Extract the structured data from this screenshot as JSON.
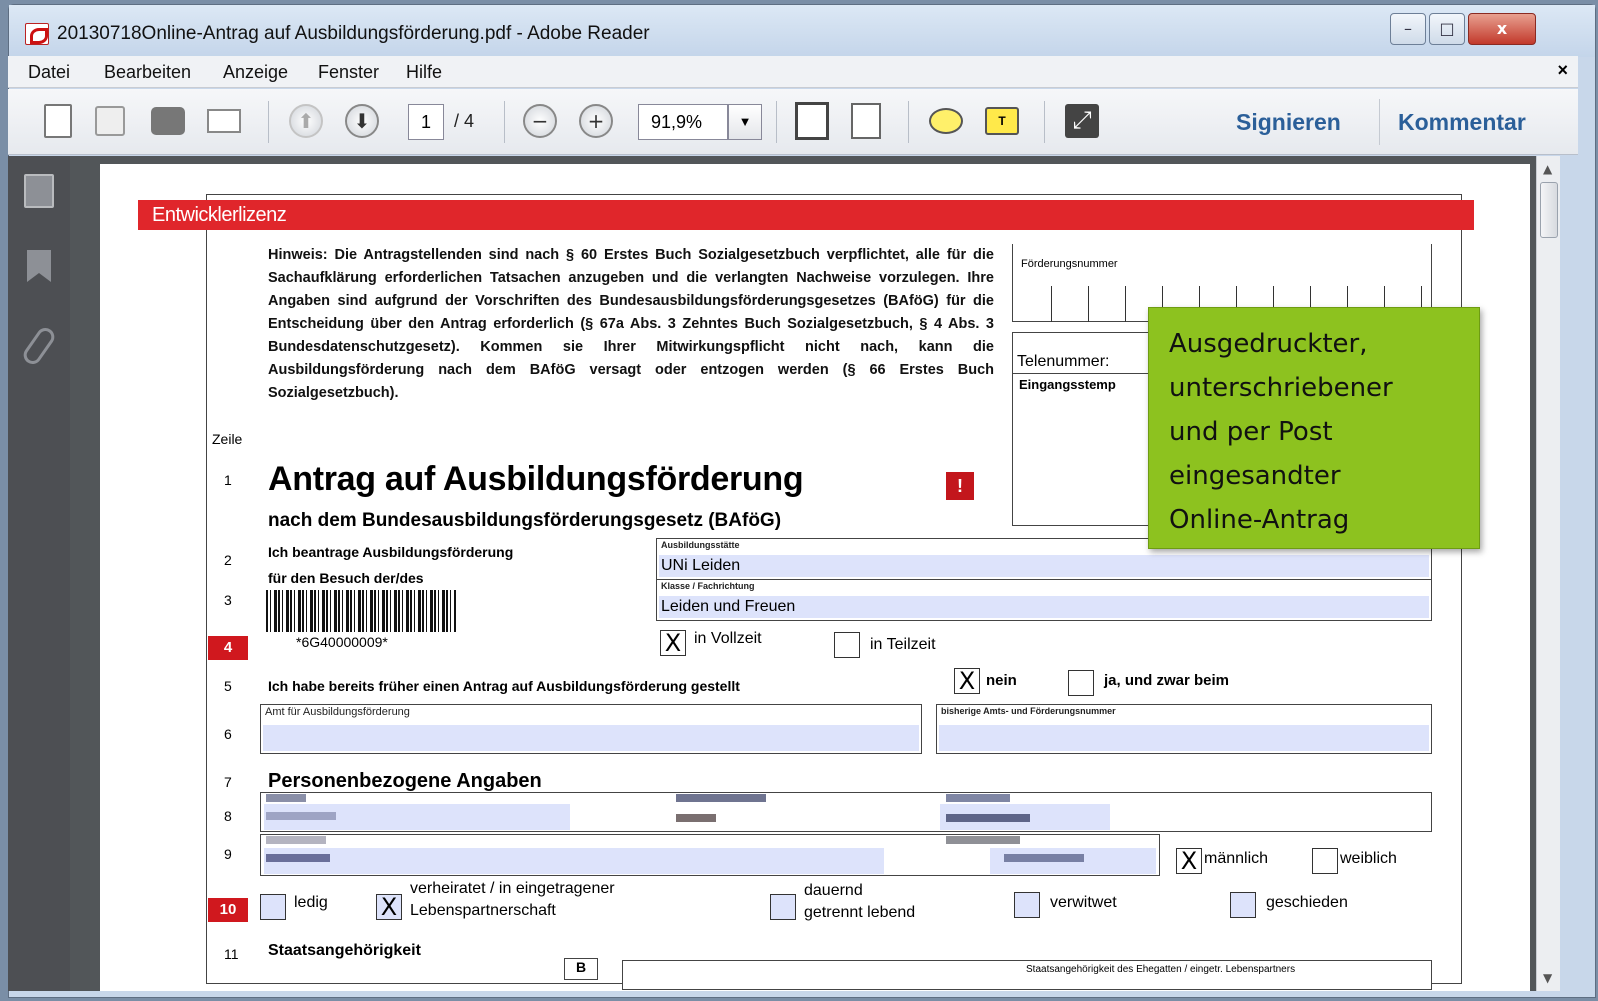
{
  "window": {
    "title": "20130718Online-Antrag auf Ausbildungsförderung.pdf - Adobe Reader",
    "min": "–",
    "max": "□",
    "close": "x"
  },
  "menu": {
    "items": [
      "Datei",
      "Bearbeiten",
      "Anzeige",
      "Fenster",
      "Hilfe"
    ],
    "close": "×"
  },
  "toolbar": {
    "page_current": "1",
    "page_total": "/ 4",
    "zoom": "91,9%",
    "zoom_dropdown": "▼",
    "sign": "Signieren",
    "comment": "Kommentar",
    "prev_page": "⬆",
    "next_page": "⬇",
    "zoom_out": "−",
    "zoom_in": "+",
    "highlight": "T"
  },
  "scrollbar": {
    "up": "▲",
    "down": "▼"
  },
  "doc": {
    "license_bar": "Entwicklerlizenz",
    "hinweis": "Hinweis: Die Antragstellenden sind nach § 60 Erstes Buch Sozialgesetzbuch verpflichtet, alle für die Sachaufklärung erforderlichen Tatsachen anzugeben und die verlangten Nachweise vorzulegen. Ihre Angaben sind aufgrund der Vorschriften des Bundesausbildungsförderungsgesetzes (BAföG) für die Entscheidung über den Antrag erforderlich (§ 67a Abs. 3 Zehntes Buch Sozialgesetzbuch, § 4 Abs. 3 Bundesdatenschutzgesetz). Kommen sie Ihrer Mitwirkungspflicht nicht nach, kann die Ausbildungsförderung nach dem BAföG versagt oder entzogen werden (§ 66 Erstes Buch Sozialgesetzbuch).",
    "foerderungsnummer_label": "Förderungsnummer",
    "telenummer_label": "Telenummer:",
    "eingangsstempel_label": "Eingangsstemp",
    "zeile": "Zeile",
    "rows": {
      "r1": "1",
      "r2": "2",
      "r3": "3",
      "r4": "4",
      "r5": "5",
      "r6": "6",
      "r7": "7",
      "r8": "8",
      "r9": "9",
      "r10": "10",
      "r11": "11"
    },
    "title": "Antrag auf Ausbildungsförderung",
    "excl": "!",
    "subtitle": "nach dem Bundesausbildungsförderungsgesetz (BAföG)",
    "beantrage": "Ich beantrage Ausbildungsförderung",
    "besuch": "für den Besuch der/des",
    "ausbildungsstaette_label": "Ausbildungsstätte",
    "ausbildungsstaette_value": "UNi Leiden",
    "klasse_label": "Klasse / Fachrichtung",
    "klasse_value": "Leiden und Freuen",
    "barcode_text": "*6G40000009*",
    "check_x": "X",
    "vollzeit": "in Vollzeit",
    "teilzeit": "in Teilzeit",
    "frueher_antrag": "Ich habe bereits früher einen Antrag auf Ausbildungsförderung gestellt",
    "nein": "nein",
    "ja_beim": "ja, und zwar beim",
    "amt_label": "Amt für Ausbildungsförderung",
    "bisherige_label": "bisherige Amts- und Förderungsnummer",
    "personenbezogene": "Personenbezogene Angaben",
    "maennlich": "männlich",
    "weiblich": "weiblich",
    "ledig": "ledig",
    "verheiratet": "verheiratet / in eingetragener",
    "lebenspartnerschaft": "Lebenspartnerschaft",
    "dauernd": "dauernd",
    "getrennt": "getrennt lebend",
    "verwitwet": "verwitwet",
    "geschieden": "geschieden",
    "staatsangehoerigkeit": "Staatsangehörigkeit",
    "b_mark": "B",
    "staats_ehegatte": "Staatsangehörigkeit des Ehegatten / eingetr. Lebenspartners"
  },
  "tooltip": {
    "line1": "Ausgedruckter,",
    "line2": "unterschriebener",
    "line3": "und per Post",
    "line4": "eingesandter",
    "line5": "Online-Antrag"
  },
  "colors": {
    "license_red": "#e0262b",
    "tooltip_green": "#8dc21f",
    "field_fill": "#dde3fb",
    "link_blue": "#2b5f99"
  },
  "icons": [
    "pdf-app-icon",
    "edit-doc-icon",
    "save-icon",
    "print-icon",
    "email-icon",
    "prev-page-icon",
    "next-page-icon",
    "zoom-out-icon",
    "zoom-in-icon",
    "fit-page-icon",
    "fit-width-icon",
    "comment-icon",
    "highlight-icon",
    "fullscreen-icon",
    "pages-panel-icon",
    "bookmarks-icon",
    "attachments-icon"
  ]
}
